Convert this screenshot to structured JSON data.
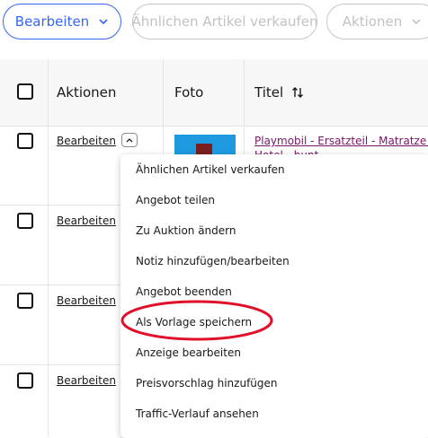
{
  "toolbar": {
    "edit_label": "Bearbeiten",
    "sell_similar_label": "Ähnlichen Artikel verkaufen",
    "actions_label": "Aktionen"
  },
  "table": {
    "headers": {
      "actions": "Aktionen",
      "photo": "Foto",
      "title": "Titel"
    },
    "rows": [
      {
        "edit_label": "Bearbeiten",
        "title": "Playmobil - Ersatzteil - Matratze C",
        "title_line2": "Hotel - bunt"
      },
      {
        "edit_label": "Bearbeiten"
      },
      {
        "edit_label": "Bearbeiten"
      },
      {
        "edit_label": "Bearbeiten"
      }
    ]
  },
  "dropdown": {
    "items": [
      "Ähnlichen Artikel verkaufen",
      "Angebot teilen",
      "Zu Auktion ändern",
      "Notiz hinzufügen/bearbeiten",
      "Angebot beenden",
      "Als Vorlage speichern",
      "Anzeige bearbeiten",
      "Preisvorschlag hinzufügen",
      "Traffic-Verlauf ansehen"
    ],
    "highlighted_index": 5
  },
  "colors": {
    "primary": "#3665f3",
    "disabled": "#c2c2c2",
    "link_title": "#7b1466",
    "highlight_ring": "#e0102b"
  }
}
